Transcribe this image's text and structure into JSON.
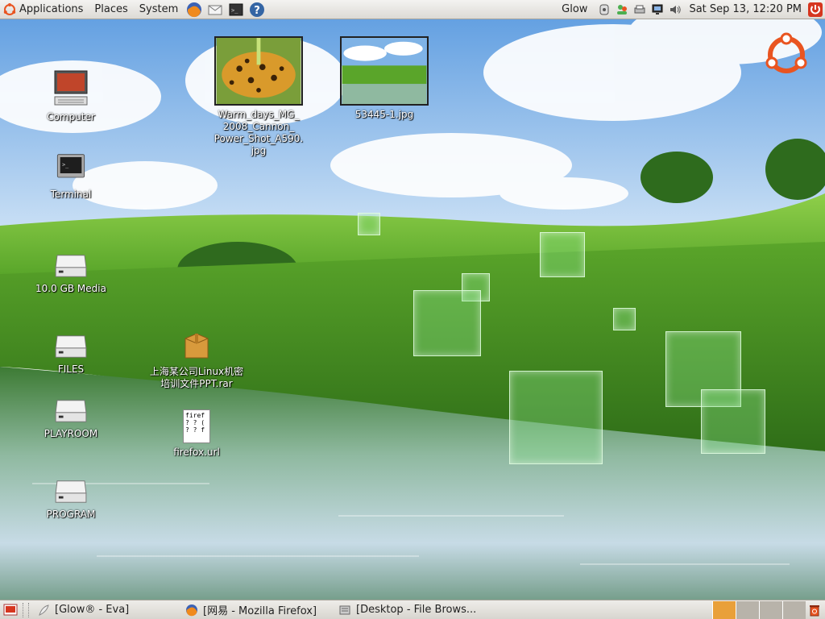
{
  "top_panel": {
    "menus": [
      "Applications",
      "Places",
      "System"
    ],
    "user": "Glow",
    "clock": "Sat Sep 13, 12:20 PM"
  },
  "desktop_icons": {
    "computer": "Computer",
    "terminal": "Terminal",
    "media": "10.0 GB Media",
    "files": "FILES",
    "playroom": "PLAYROOM",
    "program": "PROGRAM",
    "warm_days_1": "Warm_days_MG_",
    "warm_days_2": "2008_Cannon_",
    "warm_days_3": "Power_Shot_A590.",
    "warm_days_4": "jpg",
    "photo2": "53445-1.jpg",
    "rar_1": "上海某公司Linux机密",
    "rar_2": "培训文件PPT.rar",
    "firefox_url": "firefox.url",
    "url_glyph": "firef\n? ? (\n? ? f"
  },
  "bottom_panel": {
    "tasks": [
      "[Glow® - Eva]",
      "[网易 - Mozilla Firefox]",
      "[Desktop - File Brows..."
    ]
  },
  "colors": {
    "panel_bg": "#dcdad5",
    "workspace_active": "#e9a03a",
    "ubuntu_orange": "#e95420"
  }
}
